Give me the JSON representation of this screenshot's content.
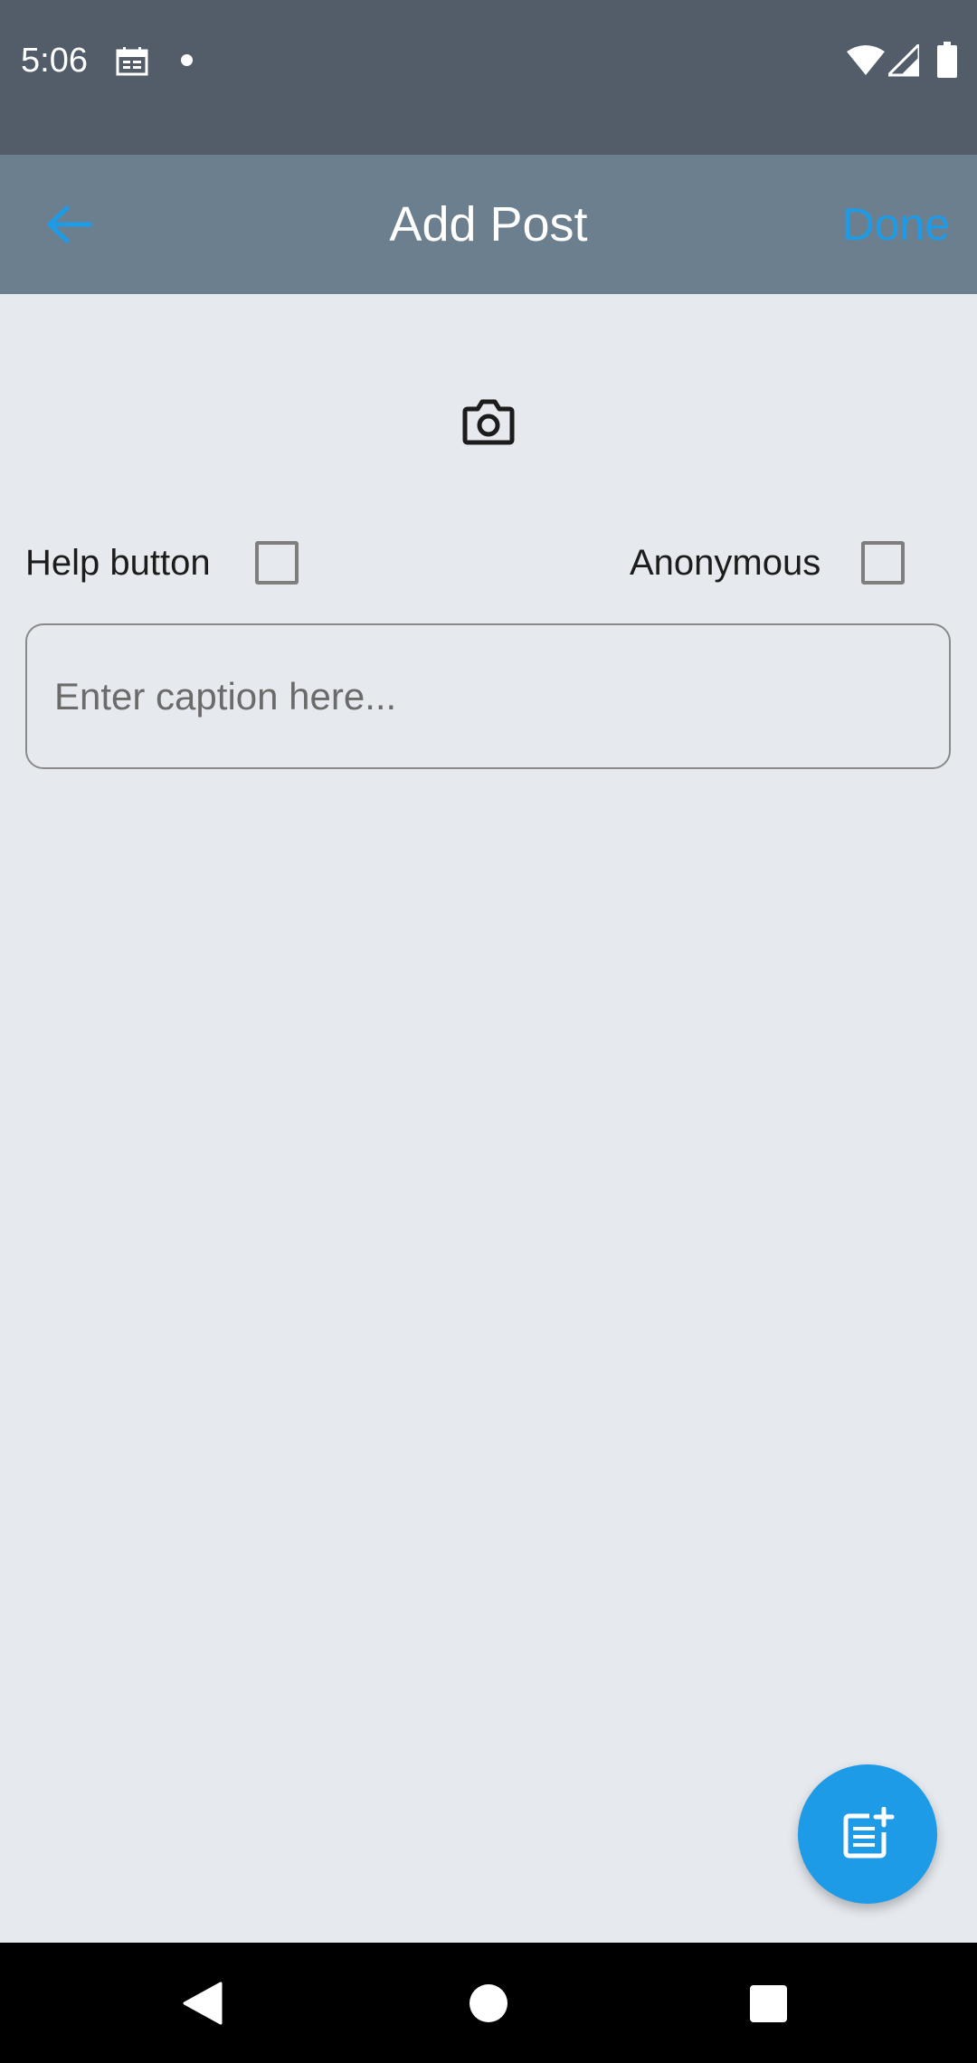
{
  "status_bar": {
    "time": "5:06",
    "icons": [
      "calendar-icon",
      "notification-dot-icon",
      "wifi-icon",
      "signal-icon",
      "battery-icon"
    ]
  },
  "app_bar": {
    "title": "Add Post",
    "back_icon": "arrow-left-icon",
    "done_label": "Done"
  },
  "form": {
    "camera_icon": "camera-icon",
    "help_label": "Help button",
    "help_checked": false,
    "anonymous_label": "Anonymous",
    "anonymous_checked": false,
    "caption": {
      "value": "",
      "placeholder": "Enter caption here..."
    }
  },
  "fab": {
    "icon": "post-add-icon"
  },
  "nav_bar": {
    "icons": [
      "nav-back-icon",
      "nav-home-icon",
      "nav-recents-icon"
    ]
  },
  "colors": {
    "status_bar": "#525d69",
    "app_bar": "#6c7f8e",
    "background": "#e6eaef",
    "accent": "#1e9be6",
    "nav_bar": "#000000"
  }
}
